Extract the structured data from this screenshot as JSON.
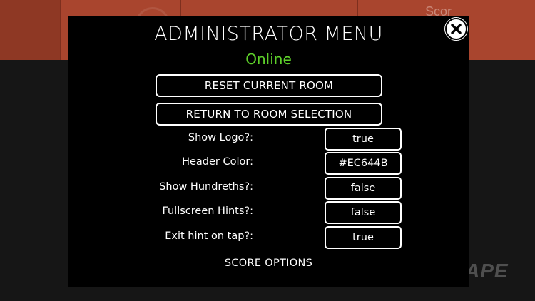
{
  "background": {
    "header_partial_text": "Scor",
    "logo_partial_text": "APE",
    "header_color": "#EC644B"
  },
  "modal": {
    "title": "ADMINISTRATOR MENU",
    "status": "Online",
    "status_color": "#5ed12a",
    "buttons": {
      "reset_label": "RESET CURRENT ROOM",
      "return_label": "RETURN TO ROOM SELECTION"
    },
    "options": [
      {
        "label": "Show Logo?:",
        "value": "true"
      },
      {
        "label": "Header Color:",
        "value": "#EC644B"
      },
      {
        "label": "Show Hundreths?:",
        "value": "false"
      },
      {
        "label": "Fullscreen Hints?:",
        "value": "false"
      },
      {
        "label": "Exit hint on tap?:",
        "value": "true"
      }
    ],
    "section_title": "SCORE OPTIONS",
    "close_icon": "close-icon"
  }
}
